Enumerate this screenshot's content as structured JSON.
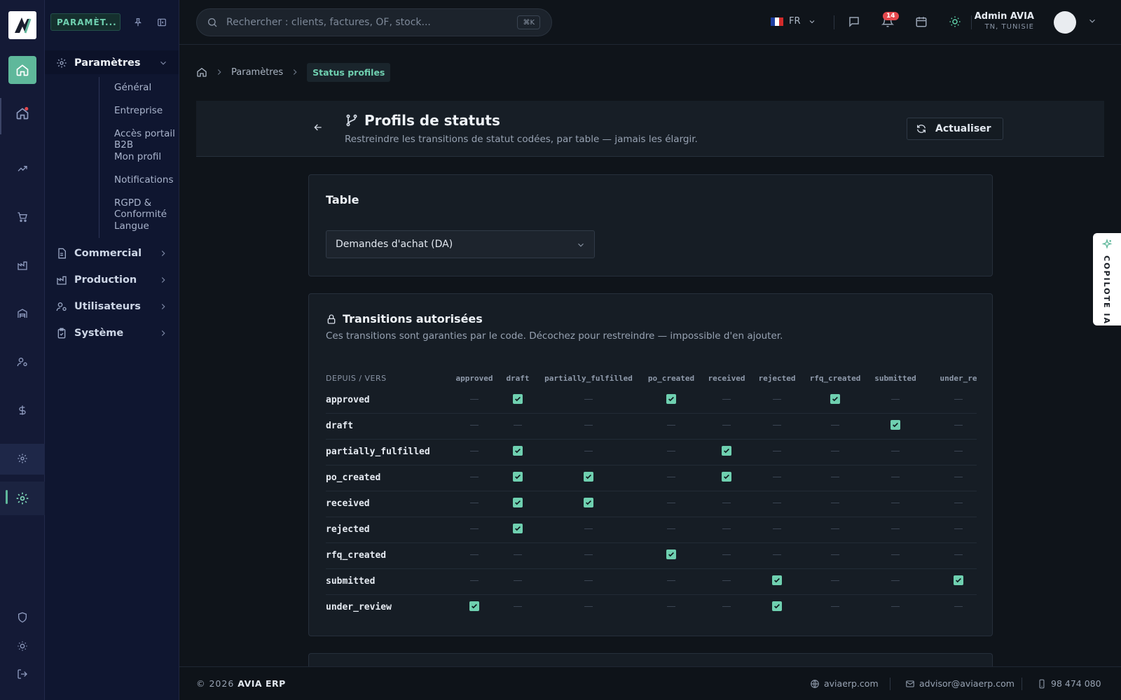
{
  "sidebar": {
    "section_chip": "PARAMÈT...",
    "groups": {
      "parametres": "Paramètres",
      "commercial": "Commercial",
      "production": "Production",
      "utilisateurs": "Utilisateurs",
      "systeme": "Système"
    },
    "items": [
      "Général",
      "Entreprise",
      "Accès portail B2B",
      "Mon profil",
      "Notifications",
      "RGPD & Conformité",
      "Langue"
    ]
  },
  "header": {
    "search_placeholder": "Rechercher : clients, factures, OF, stock...",
    "search_shortcut": "⌘K",
    "language": "FR",
    "notification_count": "14",
    "user_name": "Admin AVIA",
    "user_location": "TN, TUNISIE"
  },
  "breadcrumb": {
    "parent": "Paramètres",
    "current": "Status profiles"
  },
  "page": {
    "title": "Profils de statuts",
    "subtitle": "Restreindre les transitions de statut codées, par table — jamais les élargir.",
    "refresh_label": "Actualiser"
  },
  "table_card": {
    "title": "Table",
    "selected": "Demandes d'achat (DA)"
  },
  "transitions": {
    "title": "Transitions autorisées",
    "subtitle": "Ces transitions sont garanties par le code. Décochez pour restreindre — impossible d'en ajouter.",
    "corner_label": "DEPUIS / VERS",
    "columns": [
      "approved",
      "draft",
      "partially_fulfilled",
      "po_created",
      "received",
      "rejected",
      "rfq_created",
      "submitted",
      "under_re"
    ],
    "rows": [
      {
        "from": "approved",
        "allowed": [
          0,
          1,
          0,
          1,
          0,
          0,
          1,
          0,
          0
        ]
      },
      {
        "from": "draft",
        "allowed": [
          0,
          0,
          0,
          0,
          0,
          0,
          0,
          1,
          0
        ]
      },
      {
        "from": "partially_fulfilled",
        "allowed": [
          0,
          1,
          0,
          0,
          1,
          0,
          0,
          0,
          0
        ]
      },
      {
        "from": "po_created",
        "allowed": [
          0,
          1,
          1,
          0,
          1,
          0,
          0,
          0,
          0
        ]
      },
      {
        "from": "received",
        "allowed": [
          0,
          1,
          1,
          0,
          0,
          0,
          0,
          0,
          0
        ]
      },
      {
        "from": "rejected",
        "allowed": [
          0,
          1,
          0,
          0,
          0,
          0,
          0,
          0,
          0
        ]
      },
      {
        "from": "rfq_created",
        "allowed": [
          0,
          0,
          0,
          1,
          0,
          0,
          0,
          0,
          0
        ]
      },
      {
        "from": "submitted",
        "allowed": [
          0,
          0,
          0,
          0,
          0,
          1,
          0,
          0,
          1
        ]
      },
      {
        "from": "under_review",
        "allowed": [
          1,
          0,
          0,
          0,
          0,
          1,
          0,
          0,
          0
        ]
      }
    ]
  },
  "copilot": {
    "label": "COPILOTE IA"
  },
  "footer": {
    "copyright_symbol": "©",
    "year": "2026",
    "brand": "AVIA ERP",
    "website": "aviaerp.com",
    "email": "advisor@aviaerp.com",
    "phone": "98 474 080"
  },
  "colors": {
    "accent": "#6fd0b0",
    "accent_dark": "#5fb89b",
    "badge": "#e5484d",
    "rail_bg": "#141a36",
    "page_bg": "#0f141a"
  }
}
